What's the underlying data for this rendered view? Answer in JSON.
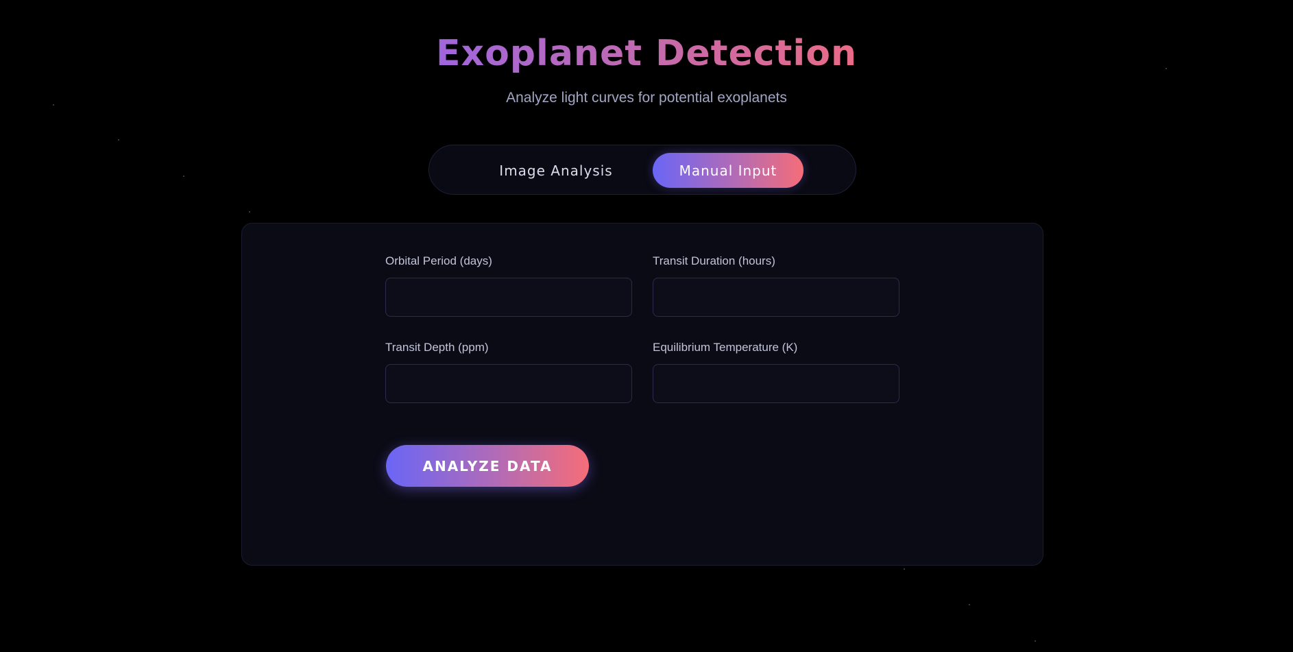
{
  "header": {
    "title": "Exoplanet Detection",
    "subtitle": "Analyze light curves for potential exoplanets"
  },
  "tabs": [
    {
      "label": "Image Analysis",
      "active": false
    },
    {
      "label": "Manual Input",
      "active": true
    }
  ],
  "form": {
    "fields": [
      {
        "label": "Orbital Period (days)",
        "value": "",
        "placeholder": ""
      },
      {
        "label": "Transit Duration (hours)",
        "value": "",
        "placeholder": ""
      },
      {
        "label": "Transit Depth (ppm)",
        "value": "",
        "placeholder": ""
      },
      {
        "label": "Equilibrium Temperature (K)",
        "value": "",
        "placeholder": ""
      }
    ],
    "submit_label": "ANALYZE DATA"
  },
  "colors": {
    "background": "#000000",
    "card": "#0b0b16",
    "gradient_start": "#6a66f6",
    "gradient_end": "#f56d78",
    "title_gradient_start": "#a066dd",
    "title_gradient_end": "#ea6b86"
  }
}
